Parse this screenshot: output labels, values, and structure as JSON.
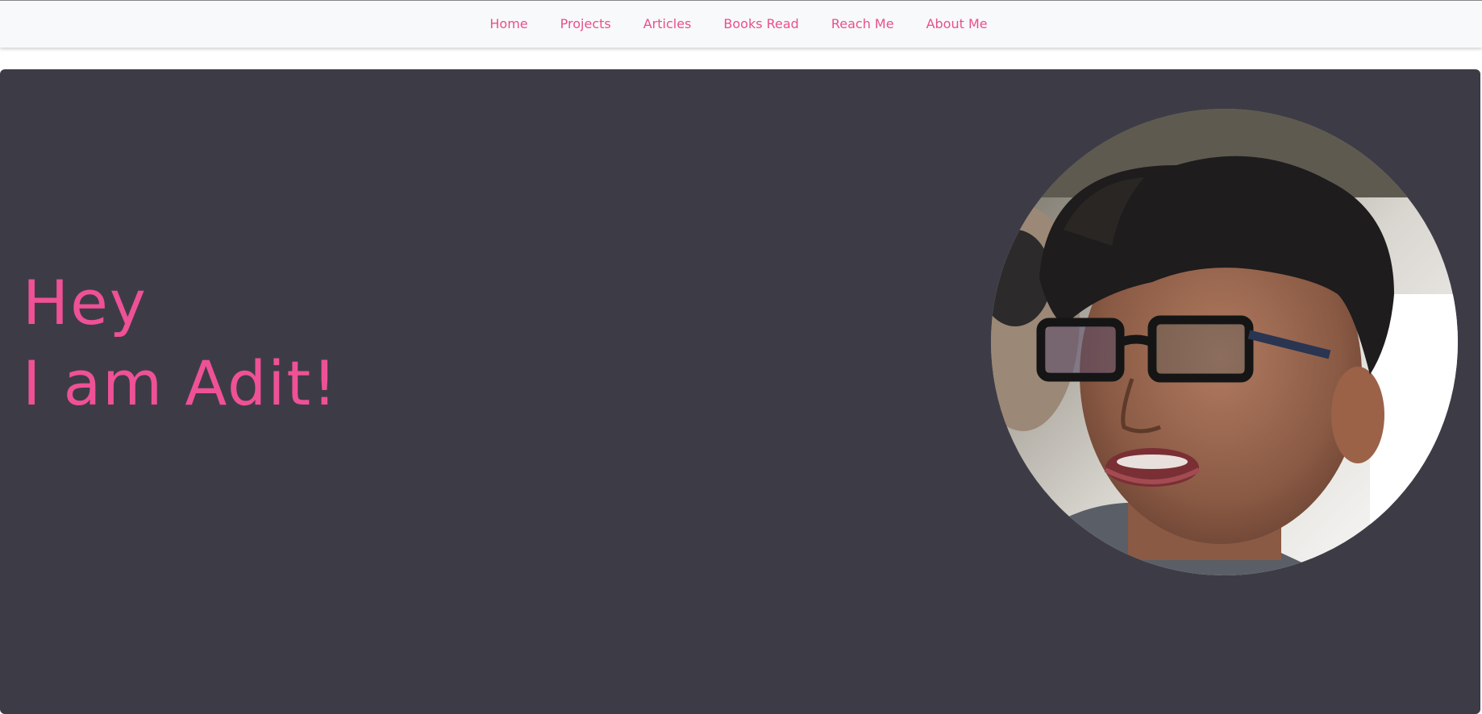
{
  "nav": {
    "items": [
      {
        "label": "Home"
      },
      {
        "label": "Projects"
      },
      {
        "label": "Articles"
      },
      {
        "label": "Books Read"
      },
      {
        "label": "Reach Me"
      },
      {
        "label": "About Me"
      }
    ]
  },
  "hero": {
    "greeting_line1": "Hey",
    "greeting_line2": "I am Adit!",
    "portrait_icon": "profile-photo"
  },
  "colors": {
    "accent": "#ef5196",
    "nav_link": "#e8508b",
    "hero_background": "#3d3c46",
    "navbar_background": "#f8f9fa"
  }
}
